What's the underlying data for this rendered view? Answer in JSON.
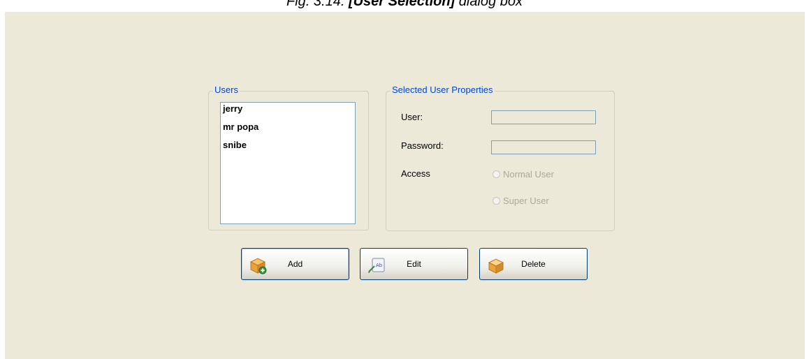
{
  "caption": {
    "prefix": "Fig. 3.14: ",
    "title": "[User Selection]",
    "suffix": " dialog box"
  },
  "users_group": {
    "legend": "Users",
    "items": [
      {
        "label": "jerry"
      },
      {
        "label": "mr popa"
      },
      {
        "label": "snibe"
      }
    ]
  },
  "properties_group": {
    "legend": "Selected User Properties",
    "user_label": "User:",
    "user_value": "",
    "password_label": "Password:",
    "password_value": "",
    "access_label": "Access",
    "access_options": [
      {
        "label": "Normal User",
        "selected": false
      },
      {
        "label": "Super User",
        "selected": false
      }
    ]
  },
  "buttons": {
    "add_label": "Add",
    "edit_label": "Edit",
    "delete_label": "Delete"
  },
  "icons": {
    "add": "box-plus-icon",
    "edit": "edit-text-icon",
    "delete": "open-box-icon"
  },
  "colors": {
    "dialog_background": "#ece9d8",
    "legend_text": "#0046d5",
    "button_border": "#003c74"
  }
}
